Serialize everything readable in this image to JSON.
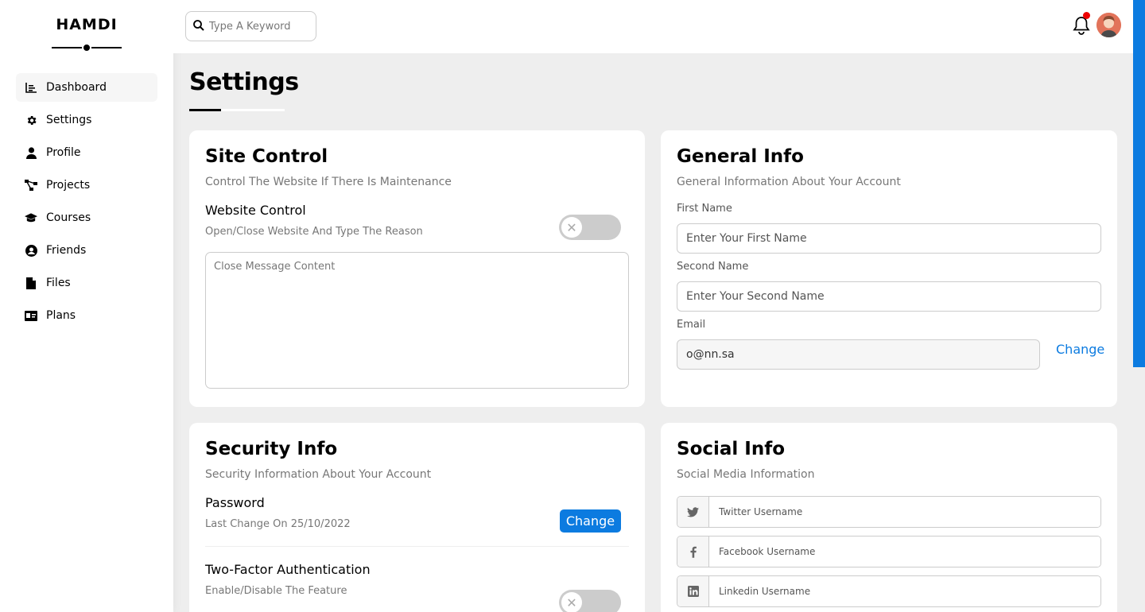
{
  "brand": {
    "name": "HAMDI"
  },
  "sidebar": {
    "items": [
      {
        "label": "Dashboard",
        "icon": "chart-icon",
        "active": true
      },
      {
        "label": "Settings",
        "icon": "gear-icon"
      },
      {
        "label": "Profile",
        "icon": "user-icon"
      },
      {
        "label": "Projects",
        "icon": "diagram-icon"
      },
      {
        "label": "Courses",
        "icon": "graduation-cap-icon"
      },
      {
        "label": "Friends",
        "icon": "circle-user-icon"
      },
      {
        "label": "Files",
        "icon": "file-icon"
      },
      {
        "label": "Plans",
        "icon": "id-card-icon"
      }
    ]
  },
  "header": {
    "search_placeholder": "Type A Keyword",
    "notification_icon": "bell-icon",
    "has_notification": true
  },
  "page": {
    "title": "Settings"
  },
  "site_control": {
    "title": "Site Control",
    "subtitle": "Control The Website If There Is Maintenance",
    "row_title": "Website Control",
    "row_sub": "Open/Close Website And Type The Reason",
    "toggle_on": false,
    "textarea_placeholder": "Close Message Content"
  },
  "general_info": {
    "title": "General Info",
    "subtitle": "General Information About Your Account",
    "first_name_label": "First Name",
    "first_name_placeholder": "Enter Your First Name",
    "second_name_label": "Second Name",
    "second_name_placeholder": "Enter Your Second Name",
    "email_label": "Email",
    "email_value": "o@nn.sa",
    "change_label": "Change"
  },
  "security_info": {
    "title": "Security Info",
    "subtitle": "Security Information About Your Account",
    "password_title": "Password",
    "password_sub": "Last Change On 25/10/2022",
    "change_label": "Change",
    "twofa_title": "Two-Factor Authentication",
    "twofa_sub": "Enable/Disable The Feature",
    "twofa_on": false
  },
  "social_info": {
    "title": "Social Info",
    "subtitle": "Social Media Information",
    "twitter_placeholder": "Twitter Username",
    "facebook_placeholder": "Facebook Username",
    "linkedin_placeholder": "Linkedin Username"
  },
  "colors": {
    "accent": "#0c7be0",
    "toggle_off": "#cccccc",
    "badge": "#ee0000"
  }
}
